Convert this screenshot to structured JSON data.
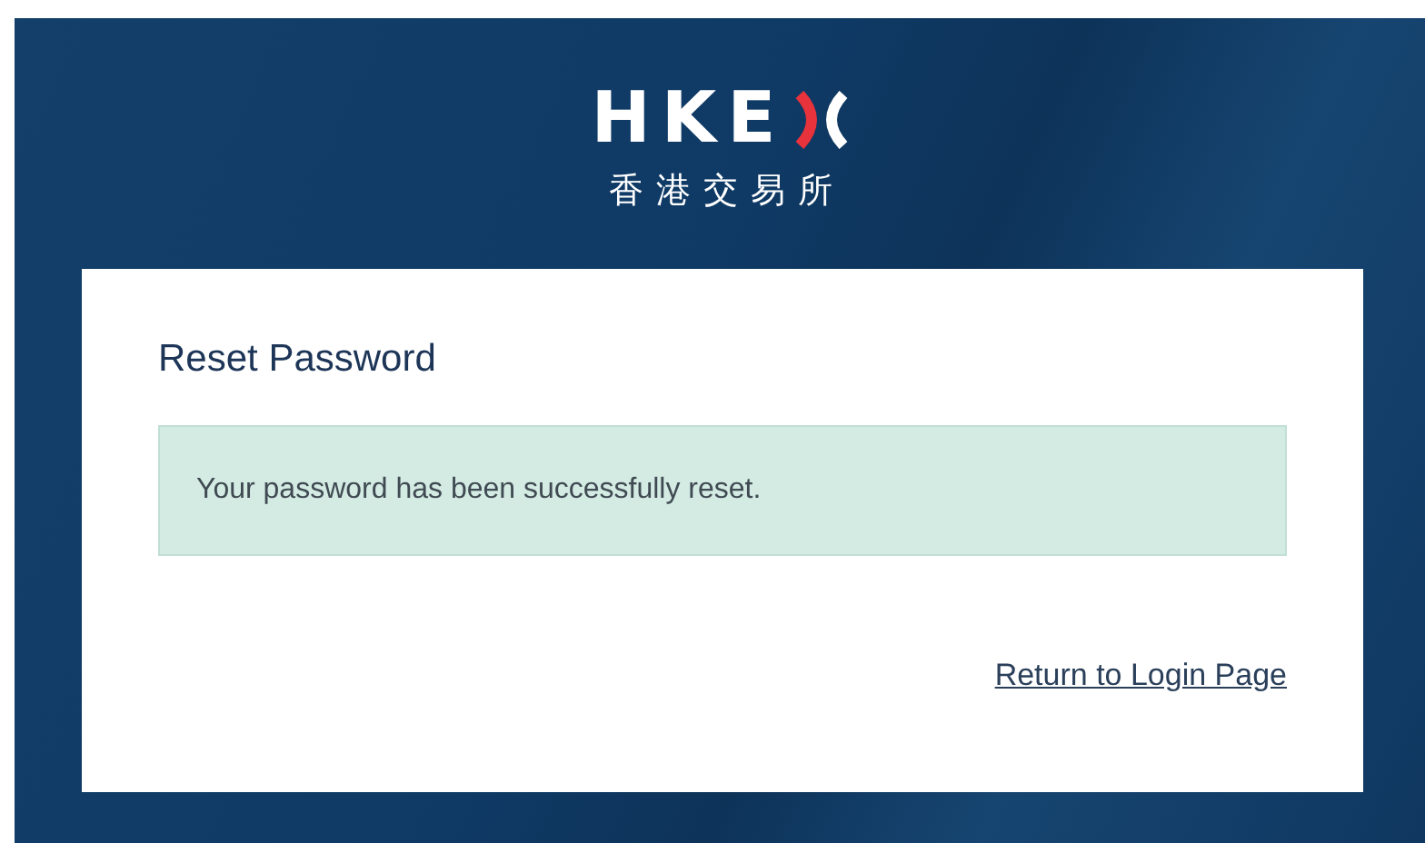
{
  "logo": {
    "wordmark": "HKE",
    "chinese": "香港交易所"
  },
  "card": {
    "title": "Reset Password",
    "message": "Your password has been successfully reset.",
    "link": "Return to Login Page"
  }
}
